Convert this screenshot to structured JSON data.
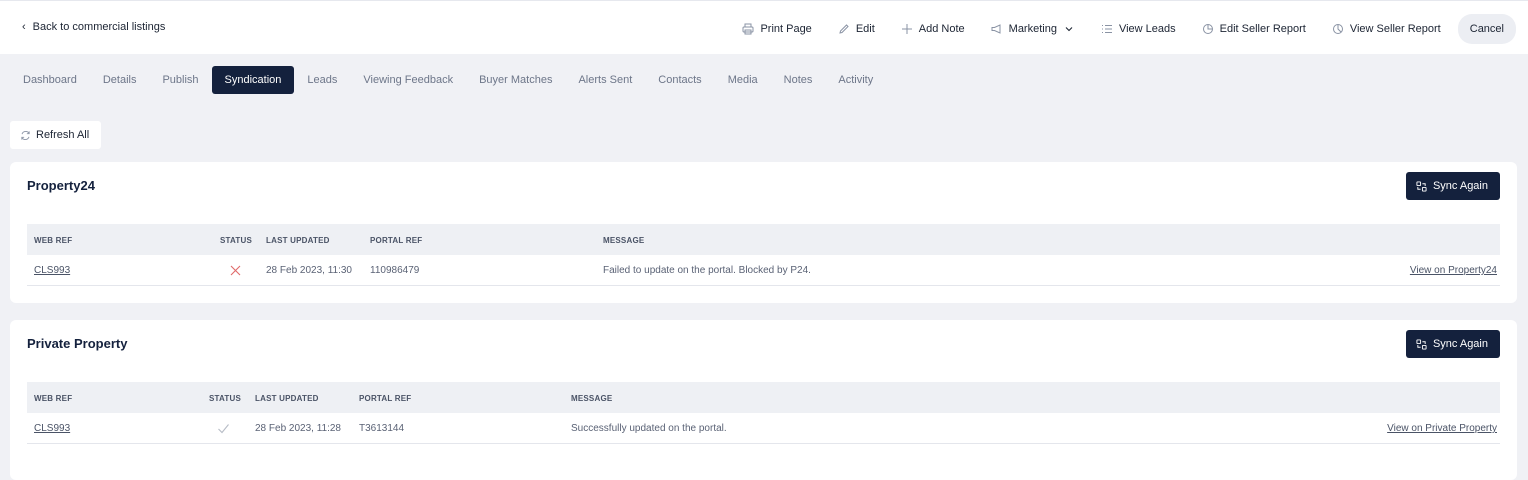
{
  "topbar": {
    "back_label": "Back to commercial listings",
    "actions": {
      "print": "Print Page",
      "edit": "Edit",
      "add_note": "Add Note",
      "marketing": "Marketing",
      "view_leads": "View Leads",
      "edit_seller_report": "Edit Seller Report",
      "view_seller_report": "View Seller Report",
      "cancel": "Cancel"
    }
  },
  "tabs": [
    "Dashboard",
    "Details",
    "Publish",
    "Syndication",
    "Leads",
    "Viewing Feedback",
    "Buyer Matches",
    "Alerts Sent",
    "Contacts",
    "Media",
    "Notes",
    "Activity"
  ],
  "active_tab": "Syndication",
  "refresh_label": "Refresh All",
  "table_headers": {
    "web_ref": "WEB REF",
    "status": "STATUS",
    "last_updated": "LAST UPDATED",
    "portal_ref": "PORTAL REF",
    "message": "MESSAGE"
  },
  "portals": [
    {
      "name": "Property24",
      "sync_label": "Sync Again",
      "row": {
        "web_ref": "CLS993",
        "status": "failed",
        "last_updated": "28 Feb 2023, 11:30",
        "portal_ref": "110986479",
        "message": "Failed to update on the portal. Blocked by P24.",
        "view_link": "View on Property24"
      }
    },
    {
      "name": "Private Property",
      "sync_label": "Sync Again",
      "row": {
        "web_ref": "CLS993",
        "status": "success",
        "last_updated": "28 Feb 2023, 11:28",
        "portal_ref": "T3613144",
        "message": "Successfully updated on the portal.",
        "view_link": "View on Private Property"
      }
    }
  ],
  "colors": {
    "primary": "#14213d",
    "page_bg": "#f0f1f5",
    "failed": "#e06a6a",
    "success": "#b7bcc6"
  }
}
